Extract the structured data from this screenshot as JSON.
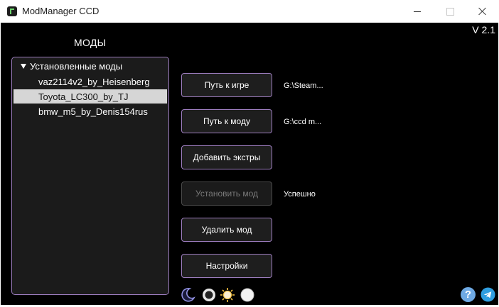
{
  "window": {
    "title": "ModManager CCD"
  },
  "header": {
    "version": "V 2.1",
    "mods_heading": "МОДЫ"
  },
  "tree": {
    "group_label": "Установленные моды",
    "items": [
      {
        "label": "vaz2114v2_by_Heisenberg",
        "selected": false
      },
      {
        "label": "Toyota_LC300_by_TJ",
        "selected": true
      },
      {
        "label": "bmw_m5_by_Denis154rus",
        "selected": false
      }
    ]
  },
  "buttons": {
    "game_path": "Путь к игре",
    "mod_path": "Путь к моду",
    "add_extras": "Добавить экстры",
    "install_mod": "Установить мод",
    "delete_mod": "Удалить мод",
    "settings": "Настройки"
  },
  "status": {
    "game_path_value": "G:\\Steam...",
    "mod_path_value": "G:\\ccd m...",
    "install_result": "Успешно"
  },
  "icons": {
    "theme_icons": [
      "moon-icon",
      "dark-theme-icon",
      "sun-icon",
      "light-theme-icon"
    ],
    "help": "?",
    "telegram": "telegram-icon"
  },
  "colors": {
    "background": "#000000",
    "accent_border": "#9d7dbf",
    "selection": "#d6d6d6",
    "help": "#6ea9e4",
    "telegram": "#2f9ee0"
  }
}
